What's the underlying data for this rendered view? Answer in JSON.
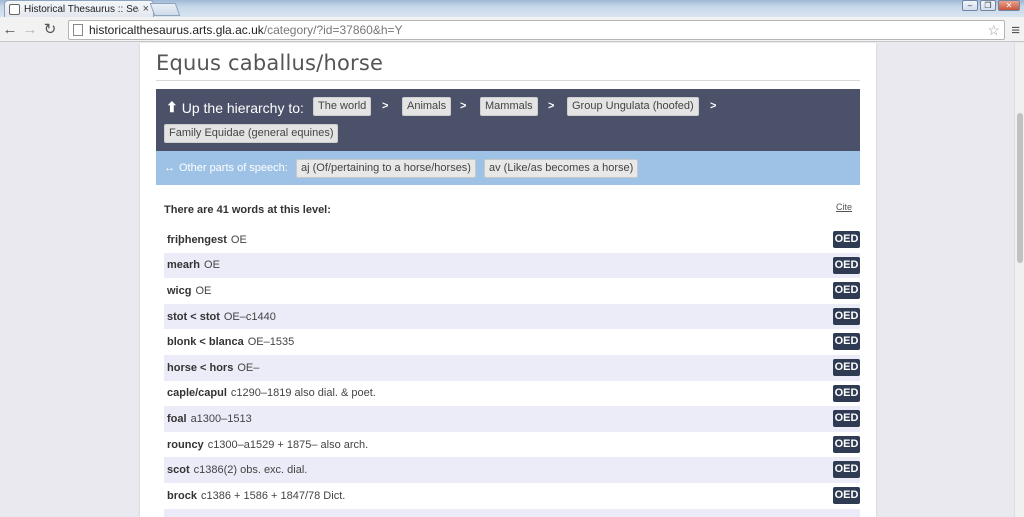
{
  "browser": {
    "tab_title": "Historical Thesaurus :: Sea",
    "tab_close": "×",
    "url_host": "historicalthesaurus.arts.gla.ac.uk",
    "url_path": "/category/?id=37860&h=Y",
    "icons": [
      "back-icon",
      "forward-icon",
      "reload-icon",
      "page-icon",
      "star-icon",
      "menu-icon"
    ]
  },
  "page": {
    "title": "Equus caballus/horse",
    "hierarchy_label": "Up the hierarchy to:",
    "hierarchy": [
      "The world",
      "Animals",
      "Mammals",
      "Group Ungulata (hoofed)",
      "Family Equidae (general equines)"
    ],
    "separator": ">",
    "pos_label": "Other parts of speech:",
    "parts_of_speech": [
      "aj (Of/pertaining to a horse/horses)",
      "av (Like/as becomes a horse)"
    ],
    "count_text": "There are 41 words at this level:",
    "cite_label": "Cite",
    "oed_label": "OED",
    "words": [
      {
        "word": "friþhengest",
        "info": "OE"
      },
      {
        "word": "mearh",
        "info": "OE"
      },
      {
        "word": "wicg",
        "info": "OE"
      },
      {
        "word": "stot < stot",
        "info": "OE–c1440"
      },
      {
        "word": "blonk < blanca",
        "info": "OE–1535"
      },
      {
        "word": "horse < hors",
        "info": "OE–"
      },
      {
        "word": "caple/capul",
        "info": "c1290–1819 also dial. & poet."
      },
      {
        "word": "foal",
        "info": "a1300–1513"
      },
      {
        "word": "rouncy",
        "info": "c1300–a1529 + 1875– also arch."
      },
      {
        "word": "scot",
        "info": "c1386(2) obs. exc. dial."
      },
      {
        "word": "brock",
        "info": "c1386 + 1586 + 1847/78 Dict."
      }
    ]
  },
  "colors": {
    "hierarchy_bg": "#4a5169",
    "pos_bg": "#9ec2e6",
    "row_alt": "#ececf8",
    "oed_bg": "#2f3b52"
  }
}
